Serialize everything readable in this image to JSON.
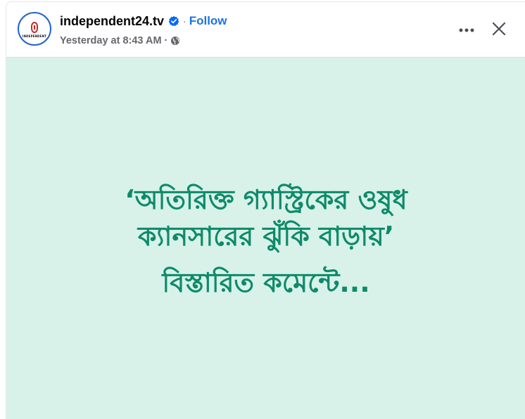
{
  "post": {
    "page_name": "independent24.tv",
    "follow_label": "Follow",
    "separator": "·",
    "timestamp": "Yesterday at 8:43 AM",
    "meta_separator": "·",
    "audience_icon": "globe-icon",
    "verified_icon": "verified-badge-icon",
    "avatar_text": "INDEPENDENT"
  },
  "actions": {
    "more_icon": "more-options-icon",
    "close_icon": "close-icon"
  },
  "image": {
    "quote_line_1": "‘অতিরিক্ত গ্যাস্ট্রিকের ওষুধ",
    "quote_line_2": "ক্যানসারের ঝুঁকি বাড়ায়’",
    "details_line": "বিস্তারিত কমেন্টে...",
    "background_color": "#d8f2e9",
    "text_color": "#0e8a6a"
  },
  "colors": {
    "brand_blue": "#1b74e4",
    "avatar_ring": "#2563c9",
    "logo_red": "#c8282c",
    "muted_text": "#65676b"
  }
}
